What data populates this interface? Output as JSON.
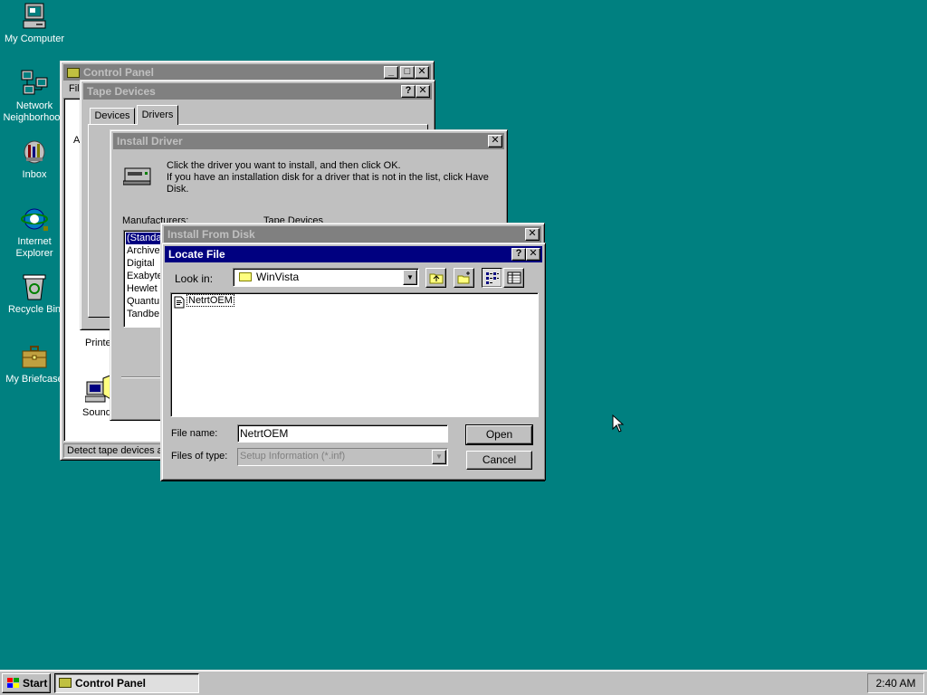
{
  "desktop": {
    "icons": [
      {
        "label": "My Computer",
        "icon": "computer-icon"
      },
      {
        "label": "Network Neighborhood",
        "line1": "Network",
        "line2": "Neighborhood",
        "icon": "network-icon"
      },
      {
        "label": "Inbox",
        "icon": "inbox-icon"
      },
      {
        "label": "Internet Explorer",
        "line1": "Internet",
        "line2": "Explorer",
        "icon": "ie-icon"
      },
      {
        "label": "Recycle Bin",
        "icon": "recycle-bin-icon"
      },
      {
        "label": "My Briefcase",
        "icon": "briefcase-icon"
      }
    ]
  },
  "control_panel": {
    "title": "Control Panel",
    "menu_fragment": "Fil",
    "side_fragment": "A",
    "items": [
      {
        "label": "Printer"
      },
      {
        "label": "Sound"
      }
    ],
    "status": "Detect tape devices a"
  },
  "tape_devices": {
    "title": "Tape Devices",
    "tabs": [
      "Devices",
      "Drivers"
    ],
    "active_tab": "Drivers"
  },
  "install_driver": {
    "title": "Install Driver",
    "instruction1": "Click the driver you want to install, and then click OK.",
    "instruction2": "If you have an installation disk for a driver that is not in the list, click Have",
    "instruction3": "Disk.",
    "manufacturers_label": "Manufacturers:",
    "tape_devices_label": "Tape Devices",
    "manufacturers": [
      "(Standa",
      "Archive",
      "Digital",
      "Exabyte",
      "Hewlet",
      "Quantu",
      "Tandbe"
    ]
  },
  "install_from_disk": {
    "title": "Install From Disk"
  },
  "locate_file": {
    "title": "Locate File",
    "look_in_label": "Look in:",
    "look_in_value": "WinVista",
    "files": [
      {
        "name": "NetrtOEM",
        "icon": "inf-file-icon"
      }
    ],
    "file_name_label": "File name:",
    "file_name_value": "NetrtOEM",
    "files_of_type_label": "Files of type:",
    "files_of_type_value": "Setup Information (*.inf)",
    "open_label": "Open",
    "cancel_label": "Cancel"
  },
  "taskbar": {
    "start_label": "Start",
    "tasks": [
      {
        "label": "Control Panel"
      }
    ],
    "clock": "2:40 AM"
  },
  "colors": {
    "desktop": "#008080",
    "face": "#c0c0c0",
    "active_title": "#000080",
    "inactive_title": "#808080"
  }
}
